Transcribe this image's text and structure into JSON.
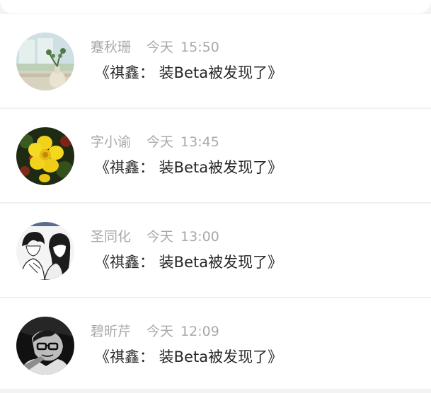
{
  "comments": [
    {
      "name": "蹇秋珊",
      "date": "今天",
      "time": "15:50",
      "message": "《祺鑫： 装Beta被发现了》",
      "avatar_icon": "vase-plant-icon"
    },
    {
      "name": "字小谕",
      "date": "今天",
      "time": "13:45",
      "message": "《祺鑫： 装Beta被发现了》",
      "avatar_icon": "yellow-flower-icon"
    },
    {
      "name": "圣同化",
      "date": "今天",
      "time": "13:00",
      "message": "《祺鑫： 装Beta被发现了》",
      "avatar_icon": "anime-couple-icon"
    },
    {
      "name": "碧昕芹",
      "date": "今天",
      "time": "12:09",
      "message": "《祺鑫： 装Beta被发现了》",
      "avatar_icon": "bw-portrait-icon"
    }
  ],
  "colors": {
    "page_background": "#f3f3f3",
    "meta_text": "#a9a9a9",
    "message_text": "#262626",
    "divider": "#f1f1f1"
  }
}
